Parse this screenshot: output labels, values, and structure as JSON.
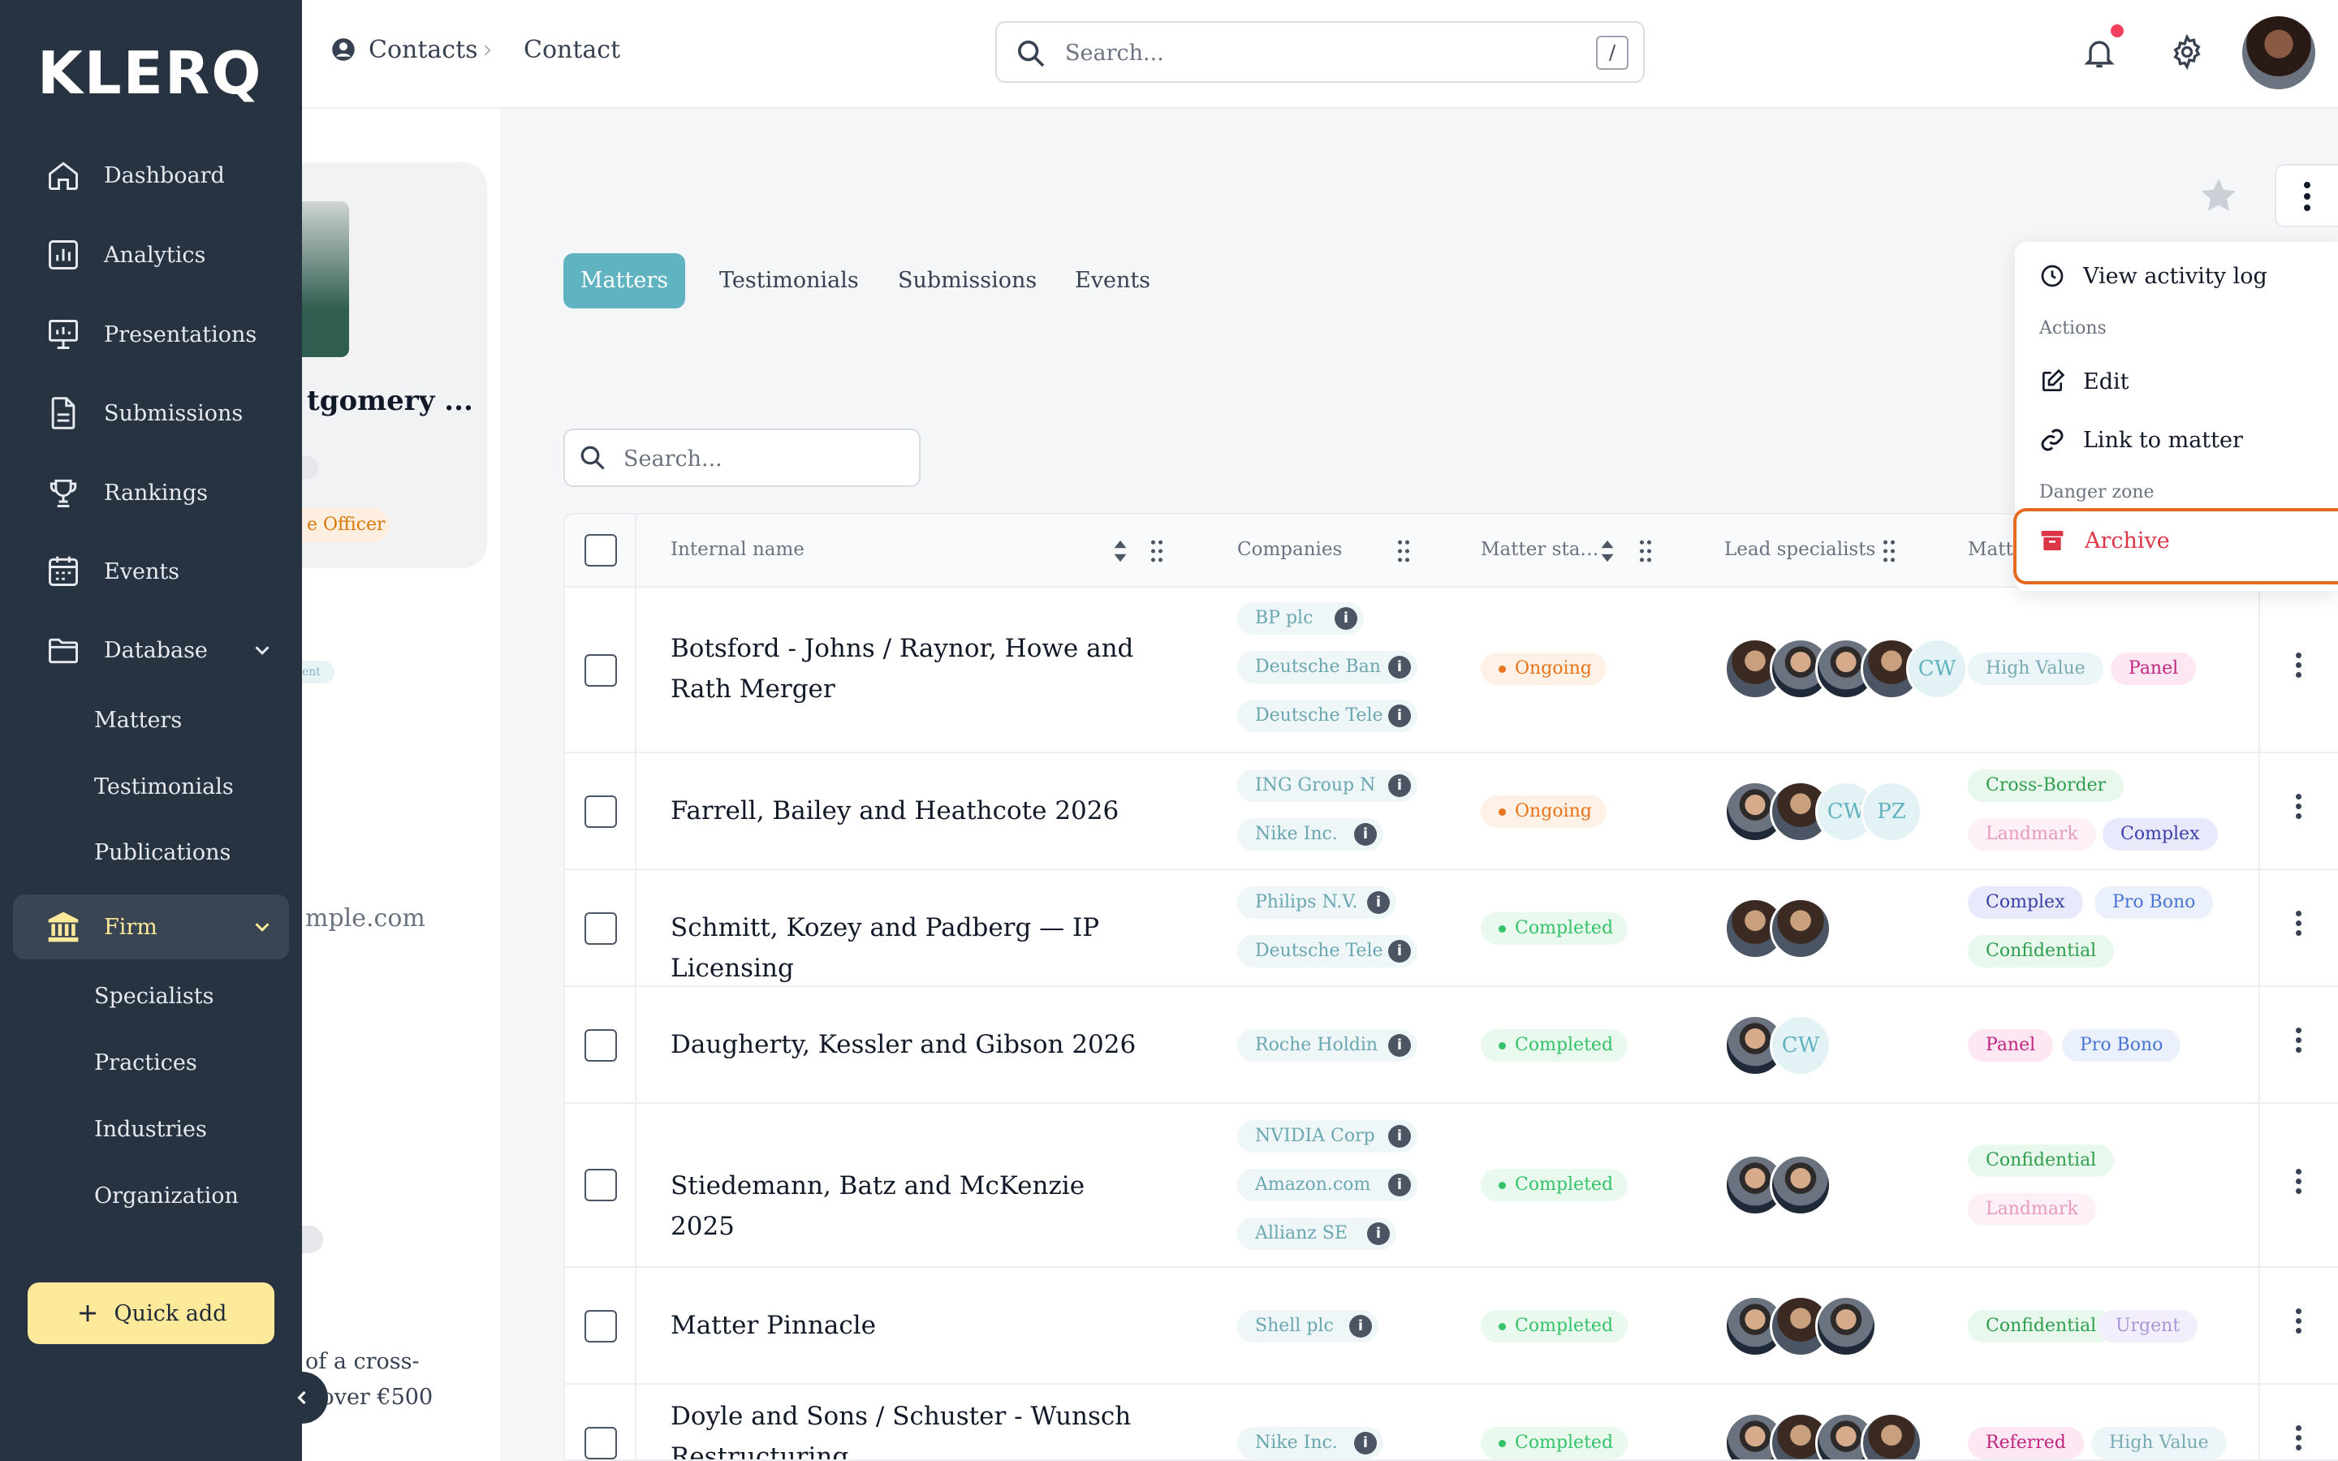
{
  "brand": "KLERQ",
  "sidebar": {
    "items": [
      {
        "label": "Dashboard",
        "icon": "home-icon"
      },
      {
        "label": "Analytics",
        "icon": "bar-chart-icon"
      },
      {
        "label": "Presentations",
        "icon": "presentation-icon"
      },
      {
        "label": "Submissions",
        "icon": "document-icon"
      },
      {
        "label": "Rankings",
        "icon": "trophy-icon"
      },
      {
        "label": "Events",
        "icon": "calendar-icon"
      },
      {
        "label": "Database",
        "icon": "folder-icon"
      }
    ],
    "database_sub": [
      "Matters",
      "Testimonials",
      "Publications"
    ],
    "firm": {
      "label": "Firm",
      "icon": "bank-icon"
    },
    "firm_sub": [
      "Specialists",
      "Practices",
      "Industries",
      "Organization"
    ],
    "quick_add": "Quick add"
  },
  "breadcrumb": {
    "contacts": "Contacts",
    "contact": "Contact"
  },
  "top_search": {
    "placeholder": "Search...",
    "shortcut": "/"
  },
  "profile": {
    "name_fragment": "tgomery ...",
    "role_fragment": "e Officer",
    "tag_fragment": "ent",
    "email_fragment": "mple.com",
    "desc_line1": "of a cross-",
    "desc_line2": "t over €500"
  },
  "tabs": [
    "Matters",
    "Testimonials",
    "Submissions",
    "Events"
  ],
  "table_search": {
    "placeholder": "Search..."
  },
  "columns": {
    "internal_name": "Internal name",
    "companies": "Companies",
    "matter_status": "Matter sta…",
    "lead_specialists": "Lead specialists",
    "matter_tags": "Matte"
  },
  "rows": [
    {
      "name": "Botsford - Johns / Raynor, Howe and Rath Merger",
      "companies": [
        "BP plc",
        "Deutsche Ban",
        "Deutsche Tele"
      ],
      "status": "Ongoing",
      "tags": [
        "High Value",
        "Panel"
      ]
    },
    {
      "name": "Farrell, Bailey and Heathcote 2026",
      "companies": [
        "ING Group N",
        "Nike Inc."
      ],
      "status": "Ongoing",
      "tags": [
        "Cross-Border",
        "Landmark",
        "Complex"
      ]
    },
    {
      "name": "Schmitt, Kozey and Padberg — IP Licensing",
      "companies": [
        "Philips N.V.",
        "Deutsche Tele"
      ],
      "status": "Completed",
      "tags": [
        "Complex",
        "Pro Bono",
        "Confidential"
      ]
    },
    {
      "name": "Daugherty, Kessler and Gibson 2026",
      "companies": [
        "Roche Holdin"
      ],
      "status": "Completed",
      "tags": [
        "Panel",
        "Pro Bono"
      ]
    },
    {
      "name": "Stiedemann, Batz and McKenzie 2025",
      "companies": [
        "NVIDIA Corp",
        "Amazon.com",
        "Allianz SE"
      ],
      "status": "Completed",
      "tags": [
        "Confidential",
        "Landmark"
      ]
    },
    {
      "name": "Matter Pinnacle",
      "companies": [
        "Shell plc"
      ],
      "status": "Completed",
      "tags": [
        "Confidential",
        "Urgent"
      ]
    },
    {
      "name": "Doyle and Sons / Schuster - Wunsch Restructuring",
      "companies": [
        "Nike Inc."
      ],
      "status": "Completed",
      "tags": [
        "Referred",
        "High Value"
      ]
    }
  ],
  "initials": {
    "cw": "CW",
    "pz": "PZ"
  },
  "menu": {
    "activity": "View activity log",
    "actions_header": "Actions",
    "edit": "Edit",
    "link": "Link to matter",
    "danger_header": "Danger zone",
    "archive": "Archive"
  },
  "colors": {
    "sidebar": "#283341",
    "accent": "#60b4c2",
    "quick_add": "#fcea9a",
    "danger": "#dc3545",
    "highlight": "#e56a1f"
  }
}
